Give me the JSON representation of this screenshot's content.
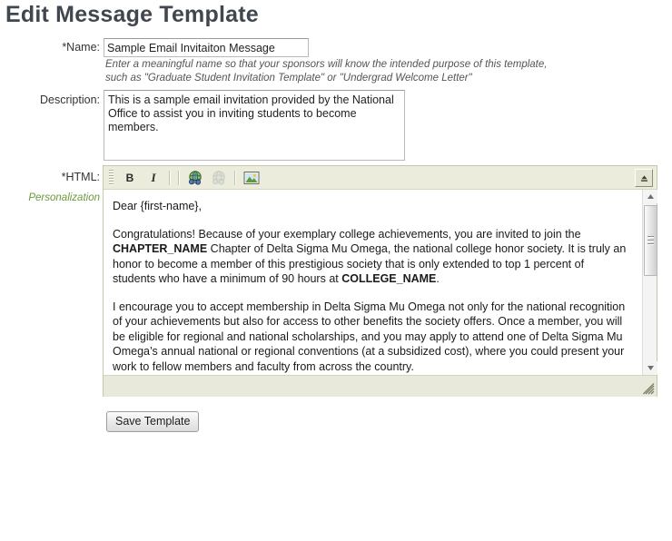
{
  "page": {
    "title": "Edit Message Template"
  },
  "form": {
    "name": {
      "label": "*Name:",
      "value": "Sample Email Invitaiton Message",
      "placeholder": "",
      "hint_line1": "Enter a meaningful name so that your sponsors will know the intended purpose of this template,",
      "hint_line2": "such as \"Graduate Student Invitation Template\" or \"Undergrad Welcome Letter\""
    },
    "description": {
      "label": "Description:",
      "value": "This is a sample email invitation provided by the National Office to assist you in inviting students to become members.",
      "placeholder": ""
    },
    "html": {
      "label": "*HTML:",
      "personalization_label": "Personalization"
    }
  },
  "editor": {
    "toolbar": {
      "grip": "drag-handle",
      "bold_label": "B",
      "italic_label": "I",
      "link_label": "",
      "unlink_label": "",
      "image_label": "",
      "toggle_label": ""
    },
    "content": {
      "greeting": "Dear {first-name},",
      "paragraph1_part1": "Congratulations! Because of your exemplary college achievements, you are invited to join the ",
      "paragraph1_token1": "CHAPTER_NAME",
      "paragraph1_part2": " Chapter of Delta Sigma Mu Omega, the national college honor society. It is truly an honor to become a member of this prestigious society that is only extended to top 1 percent of students who have a minimum of 90 hours at ",
      "paragraph1_token2": "COLLEGE_NAME",
      "paragraph1_part3": ".",
      "paragraph2": "I encourage you to accept membership in Delta Sigma Mu Omega not only for the national recognition of your achievements but also for access to other benefits the society offers. Once a member, you will be eligible for regional and national scholarships, and you may apply to attend one of Delta Sigma Mu Omega’s annual national or regional conventions (at a subsidized cost), where you could present your work to fellow members and faculty from across the country."
    },
    "status_text": ""
  },
  "actions": {
    "save_label": "Save Template"
  },
  "colors": {
    "title": "#41474f",
    "personalization": "#6b9a3a",
    "toolbar_bg": "#ececdd",
    "editor_border": "#c6c6a8",
    "status_bg": "#e9e9db"
  }
}
